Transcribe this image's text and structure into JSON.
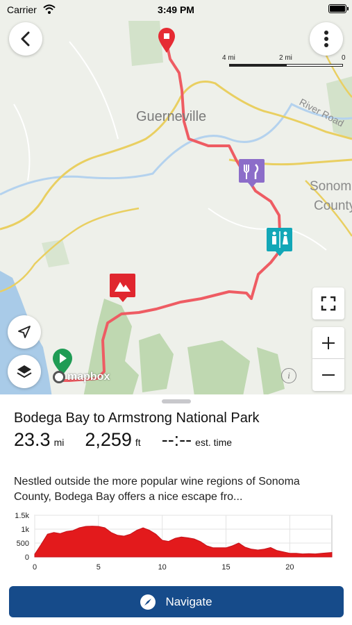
{
  "status_bar": {
    "carrier": "Carrier",
    "time": "3:49 PM"
  },
  "map": {
    "place_labels": [
      "Guerneville",
      "River Road",
      "Sonoma",
      "County"
    ],
    "scale_labels": [
      "4 mi",
      "2 mi",
      "0"
    ],
    "attribution": "mapbox",
    "route_color": "#ee5c63",
    "markers": [
      "finish-marker",
      "food-marker",
      "restroom-marker",
      "viewpoint-marker",
      "start-marker"
    ]
  },
  "route": {
    "title": "Bodega Bay to Armstrong National Park",
    "distance_value": "23.3",
    "distance_unit": "mi",
    "elevation_value": "2,259",
    "elevation_unit": "ft",
    "time_value": "--:--",
    "time_unit": "est. time",
    "description": "Nestled outside the more popular wine regions of Sonoma County, Bodega Bay offers a nice escape fro..."
  },
  "chart_data": {
    "type": "area",
    "x": [
      0,
      0.5,
      1,
      1.5,
      2,
      2.5,
      3,
      3.5,
      4,
      4.5,
      5,
      5.5,
      6,
      6.5,
      7,
      7.5,
      8,
      8.5,
      9,
      9.5,
      10,
      10.5,
      11,
      11.5,
      12,
      12.5,
      13,
      13.5,
      14,
      14.5,
      15,
      15.5,
      16,
      16.5,
      17,
      17.5,
      18,
      18.5,
      19,
      19.5,
      20,
      20.5,
      21,
      21.5,
      22,
      22.5,
      23,
      23.3
    ],
    "values": [
      100,
      450,
      820,
      880,
      840,
      920,
      950,
      1050,
      1100,
      1110,
      1100,
      1050,
      880,
      780,
      750,
      820,
      960,
      1050,
      960,
      820,
      600,
      560,
      670,
      720,
      690,
      650,
      550,
      400,
      330,
      330,
      330,
      400,
      500,
      350,
      280,
      250,
      280,
      340,
      230,
      180,
      130,
      130,
      110,
      120,
      110,
      130,
      150,
      160
    ],
    "xticks": [
      "0",
      "5",
      "10",
      "15",
      "20"
    ],
    "yticks": [
      "0",
      "500",
      "1k",
      "1.5k"
    ],
    "xlim": [
      0,
      23.3
    ],
    "ylim": [
      0,
      1500
    ],
    "fill_color": "#e31a1c"
  },
  "navigate_label": "Navigate"
}
